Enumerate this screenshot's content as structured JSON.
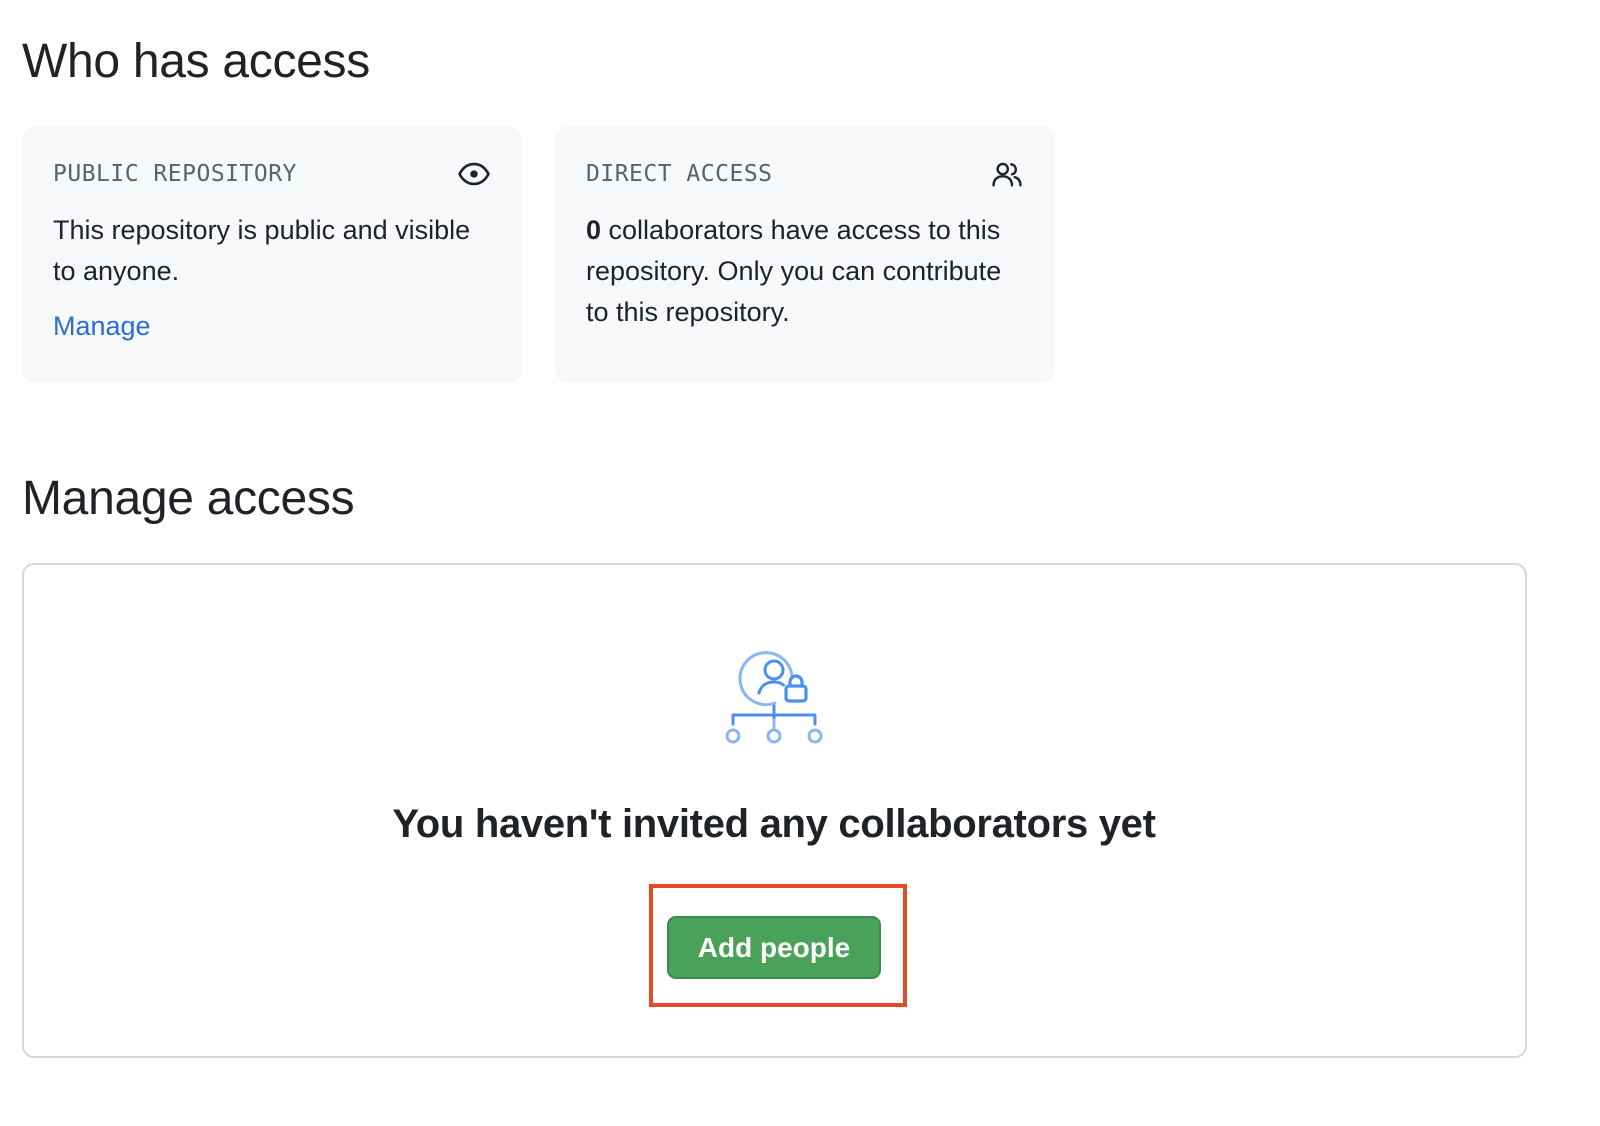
{
  "sections": {
    "who_has_access_title": "Who has access",
    "manage_access_title": "Manage access"
  },
  "public_card": {
    "kicker": "PUBLIC REPOSITORY",
    "icon": "eye-icon",
    "body": "This repository is public and visible to anyone.",
    "link_label": "Manage"
  },
  "direct_card": {
    "kicker": "DIRECT ACCESS",
    "icon": "people-icon",
    "collaborator_count": "0",
    "body_rest": " collaborators have access to this repository. Only you can contribute to this repository."
  },
  "empty_state": {
    "icon": "person-lock-network-icon",
    "title": "You haven't invited any collaborators yet",
    "button_label": "Add people"
  },
  "colors": {
    "link": "#2f6bd6",
    "button_green": "#4aa25a",
    "highlight_border": "#e34a2a",
    "illustration_blue": "#4b8ff0"
  }
}
